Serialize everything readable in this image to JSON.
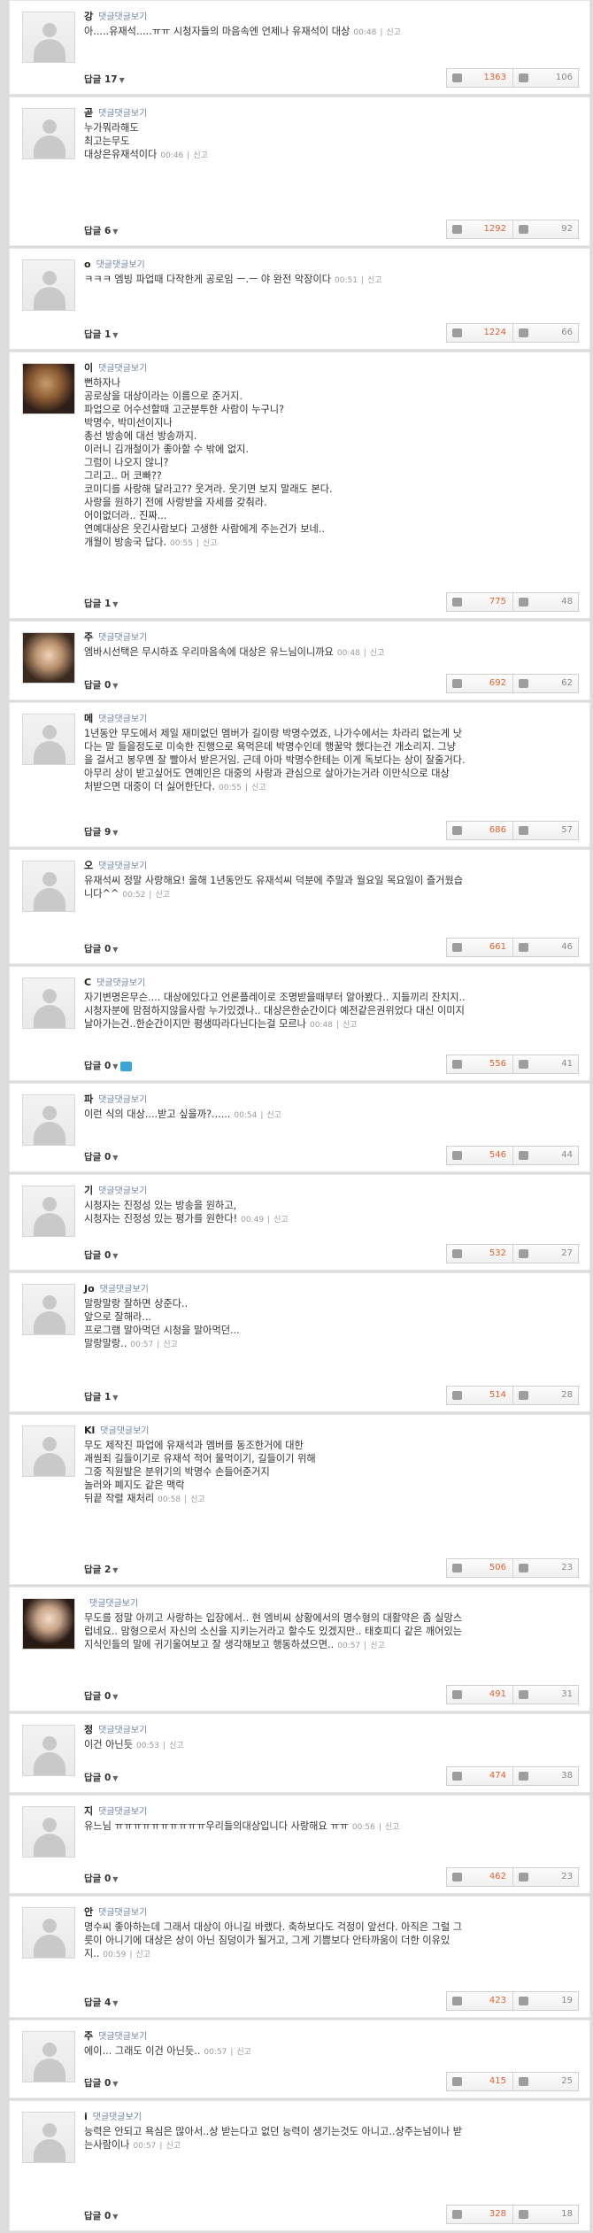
{
  "ui": {
    "reply_label": "답글",
    "blog_label": "댓글댓글보기",
    "report": "신고"
  },
  "comments": [
    {
      "name": "강",
      "lines": [
        "아.....유재석.....ㅠㅠ 시청자들의 마음속엔 언제나 유재석이 대상"
      ],
      "time": "00:48",
      "reply_count": "17",
      "up": "1363",
      "down": "106"
    },
    {
      "name": "곧",
      "lines": [
        "누가뭐라해도",
        "최고는무도",
        "대상은유재석이다"
      ],
      "time": "00:46",
      "reply_count": "6",
      "up": "1292",
      "down": "92"
    },
    {
      "name": "o",
      "lines": [
        "ㅋㅋㅋ 엠빙 파업때 다작한게 공로임 ㅡ.ㅡ 야 완전 악장이다"
      ],
      "time": "00:51",
      "reply_count": "1",
      "up": "1224",
      "down": "66"
    },
    {
      "name": "이",
      "lines": [
        "뻔하자나",
        "공로상을 대상이라는 이름으로 준거지.",
        "파업으로 어수선할때 고군분투한 사람이 누구니?",
        "박명수, 박미선이지나",
        "총선 방송에 대선 방송까지.",
        "이러니 김개철이가 좋아할 수 밖에 없지.",
        "그럼이 나오지 않니?",
        "그리고.. 머 코빠??",
        "코미디를 사랑해 달라고?? 웃겨라. 웃기면 보지 말래도 본다.",
        "사랑을 원하기 전에 사랑받을 자세를 갖춰라.",
        "어이없더라.. 진짜...",
        "연예대상은 웃긴사람보다 고생한 사람에게 주는건가 보네..",
        "개월이 방송국 답다."
      ],
      "time": "00:55",
      "reply_count": "1",
      "up": "775",
      "down": "48"
    },
    {
      "name": "주",
      "lines": [
        "엠바시선택은 무시하죠 우리마음속에 대상은 유느님이니까요"
      ],
      "time": "00:48",
      "reply_count": "0",
      "up": "692",
      "down": "62"
    },
    {
      "name": "메",
      "lines": [
        "1년동안 무도에서 제일 재미없던 멤버가 길이랑 박명수였죠, 나가수에서는 차라리 없는게 낫",
        "다는 말 들을정도로 미숙한 진행으로 욕먹은데 박명수인데 행꿀악 했다는건 개소리지. 그냥",
        "을 걸서고 봉우멘 잘 빨아서 받은거임. 근데 아마 박명수한테는 이게 독보다는 상이 잘줄거다.",
        "아무리 상이 받고싶어도 연예인은 대중의 사랑과 관심으로 살아가는거라 이만식으로 대상",
        "처받으면 대중이 더 싫어한단다."
      ],
      "time": "00:55",
      "reply_count": "9",
      "up": "686",
      "down": "57"
    },
    {
      "name": "오",
      "lines": [
        "유재석씨 정말 사랑해요! 올해 1년동안도 유재석씨 덕분에 주말과 월요일 목요일이 즐거웠습",
        "니다^^"
      ],
      "time": "00:52",
      "reply_count": "0",
      "up": "661",
      "down": "46"
    },
    {
      "name": "C",
      "lines": [
        "자기변명은무슨.... 대상에있다고 언론플레이로 조명받을때부터 알아봤다.. 지들끼리 잔치지..",
        "시청자분에 맘점하지않을사람 누가있겠나.. 대상은한순간이다 예전같은권위었다 대신 이미지",
        "날아가는건..한순간이지만 평생따라다닌다는걸 모르나"
      ],
      "time": "00:48",
      "reply_count": "0",
      "up": "556",
      "down": "41",
      "twitter": true
    },
    {
      "name": "파",
      "lines": [
        "이런 식의 대상....받고 싶을까?......"
      ],
      "time": "00:54",
      "reply_count": "0",
      "up": "546",
      "down": "44"
    },
    {
      "name": "기",
      "lines": [
        "시청자는 진정성 있는 방송을 원하고,",
        "시청자는 진정성 있는 평가를 원한다!"
      ],
      "time": "00:49",
      "reply_count": "0",
      "up": "532",
      "down": "27"
    },
    {
      "name": "Jo",
      "lines": [
        "말랑말랑 잘하면 상준다..",
        "앞으로 잘해라...",
        "프로그램 말아먹던 시청을 말아먹던...",
        "말랑말랑.."
      ],
      "time": "00:57",
      "reply_count": "1",
      "up": "514",
      "down": "28"
    },
    {
      "name": "Kl",
      "lines": [
        "무도 제작진 파업에 유재석과 멤버를 동조한거에 대한",
        "괘씸죄 길들이기로 유재석 적어 물먹이기, 길들이기 위해",
        "그중 직원발은 분위기의 박명수 손들어준거지",
        "놀러와 폐지도 같은 맥락",
        "뒤끝 작렬 재처리"
      ],
      "time": "00:58",
      "reply_count": "2",
      "up": "506",
      "down": "23"
    },
    {
      "name": "",
      "lines": [
        "무도를 정말 아끼고 사랑하는 입장에서.. 현 엠비씨 상황에서의 명수형의 대활약은 좀 실망스",
        "럽네요.. 맘형으로서 자신의 소신을 지키는거라고 할수도 있겠지만.. 태호피디 같은 깨어있는",
        "지식인들의 말에 귀기울여보고 잘 생각해보고 행동하셨으면.."
      ],
      "time": "00:57",
      "reply_count": "0",
      "up": "491",
      "down": "31"
    },
    {
      "name": "정",
      "lines": [
        "이건 아닌듯"
      ],
      "time": "00:53",
      "reply_count": "0",
      "up": "474",
      "down": "38"
    },
    {
      "name": "지",
      "lines": [
        "유느님 ㅠㅠㅠㅠㅠㅠㅠㅠㅠㅠ우리들의대상입니다 사랑해요 ㅠㅠ"
      ],
      "time": "00:56",
      "reply_count": "0",
      "up": "462",
      "down": "23"
    },
    {
      "name": "안",
      "lines": [
        "명수씨 좋아하는데 그래서 대상이 아니길 바랬다. 축하보다도 걱정이 앞선다. 아직은 그럴 그",
        "릇이 아니기에 대상은 상이 아닌 짐덩이가 될거고, 그게 기쁨보다 안타까움이 더한 이유있",
        "지.."
      ],
      "time": "00:59",
      "reply_count": "4",
      "up": "423",
      "down": "19"
    },
    {
      "name": "주",
      "lines": [
        "에이... 그래도 이건 아닌듯.."
      ],
      "time": "00:57",
      "reply_count": "0",
      "up": "415",
      "down": "25"
    },
    {
      "name": "i",
      "lines": [
        "능력은 안되고 욕심은 많아서..상 받는다고 없던 능력이 생기는것도 아니고..상주는넘이나 받",
        "는사람이나"
      ],
      "time": "00:57",
      "reply_count": "0",
      "up": "328",
      "down": "18"
    }
  ]
}
